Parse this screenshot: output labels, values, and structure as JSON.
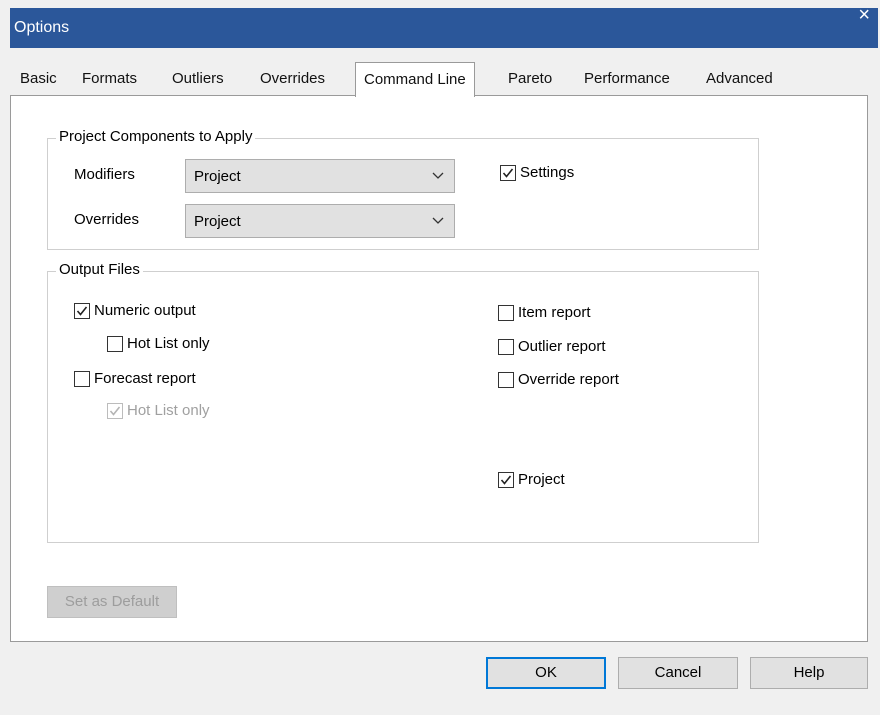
{
  "window": {
    "title": "Options",
    "close_glyph": "×"
  },
  "tabs": [
    {
      "label": "Basic"
    },
    {
      "label": "Formats"
    },
    {
      "label": "Outliers"
    },
    {
      "label": "Overrides"
    },
    {
      "label": "Command Line",
      "active": true
    },
    {
      "label": "Pareto"
    },
    {
      "label": "Performance"
    },
    {
      "label": "Advanced"
    }
  ],
  "project_components": {
    "title": "Project Components to Apply",
    "modifiers": {
      "label": "Modifiers",
      "value": "Project"
    },
    "overrides": {
      "label": "Overrides",
      "value": "Project"
    },
    "settings": {
      "label": "Settings",
      "checked": true
    }
  },
  "output_files": {
    "title": "Output Files",
    "numeric_output": {
      "label": "Numeric output",
      "checked": true
    },
    "numeric_hot_list": {
      "label": "Hot List only",
      "checked": false
    },
    "forecast_report": {
      "label": "Forecast report",
      "checked": false
    },
    "forecast_hot_list": {
      "label": "Hot List only",
      "checked": true,
      "disabled": true
    },
    "item_report": {
      "label": "Item report",
      "checked": false
    },
    "outlier_report": {
      "label": "Outlier report",
      "checked": false
    },
    "override_report": {
      "label": "Override report",
      "checked": false
    },
    "project": {
      "label": "Project",
      "checked": true
    }
  },
  "buttons": {
    "set_default": "Set as Default",
    "ok": "OK",
    "cancel": "Cancel",
    "help": "Help"
  },
  "icons": {
    "close": "close-icon",
    "dropdown": "chevron-down-icon",
    "check": "checkmark-icon"
  },
  "colors": {
    "titlebar": "#2b579a",
    "default_button_border": "#0078d7",
    "dialog_background": "#f0f0f0"
  }
}
